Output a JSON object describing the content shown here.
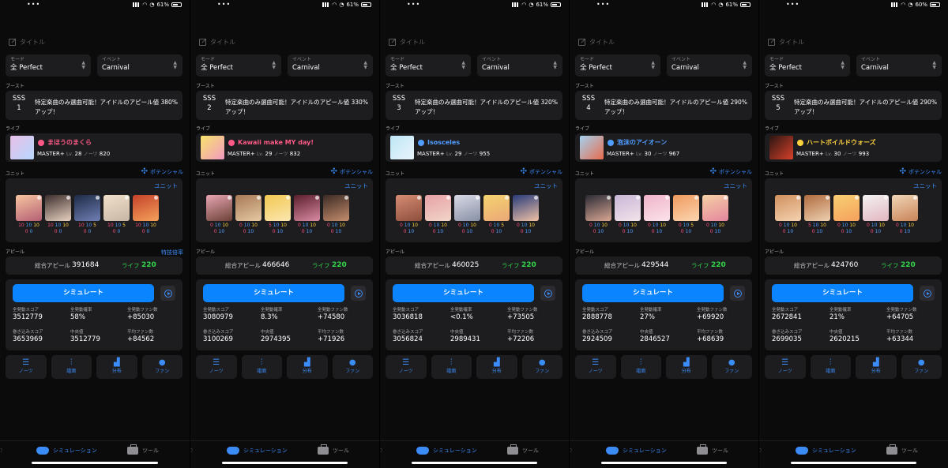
{
  "common": {
    "title_placeholder": "タイトル",
    "mode_label": "モード",
    "mode_value": "全 Perfect",
    "event_label": "イベント",
    "event_value": "Carnival",
    "boost_section": "ブースト",
    "live_section": "ライブ",
    "unit_section": "ユニット",
    "potential_label": "ポテンシャル",
    "unit_link": "ユニット",
    "appeal_section": "アピール",
    "tokugi_label": "特技倍率",
    "total_appeal_label": "総合アピール",
    "life_label": "ライフ",
    "simulate_label": "シミュレート",
    "stat_labels": {
      "full_score": "全発動スコア",
      "full_rate": "全発動確率",
      "full_fan": "全発動ファン数",
      "high_score": "巻き込みスコア",
      "median": "中央値",
      "avg_fan": "平均ファン数"
    },
    "tabs": [
      {
        "label": "ノーツ",
        "icon": "list-icon",
        "glyph": "☰"
      },
      {
        "label": "譜面",
        "icon": "sliders-icon",
        "glyph": "⫶"
      },
      {
        "label": "分布",
        "icon": "bar-chart-icon",
        "glyph": "▟"
      },
      {
        "label": "ファン",
        "icon": "person-icon",
        "glyph": "●"
      }
    ],
    "nav_simulation": "シミュレーション",
    "nav_tool": "ツール",
    "colors": {
      "accent": "#0a84ff",
      "card": "#1d1d20",
      "life_green": "#32d74b",
      "cute": "#ff4f7a",
      "cool": "#4f9dff",
      "passion": "#ffd23f"
    }
  },
  "screens": [
    {
      "battery": "61%",
      "rank": "SSS",
      "rank_num": "1",
      "boost_desc": "特定楽曲のみ選曲可能！アイドルのアピール値 380% アップ！",
      "song": {
        "title": "まほうのまくら",
        "attr": "cute",
        "color": "#ff5a86",
        "difficulty": "MASTER+",
        "level": "28",
        "notes": "820",
        "jacket": [
          "#e8c0e6",
          "#b7d7ff"
        ]
      },
      "idols": [
        {
          "points": [
            "10",
            "10",
            "10"
          ],
          "sub": [
            "0",
            "0"
          ],
          "colors": [
            "#f7c6a0",
            "#b45f74"
          ]
        },
        {
          "points": [
            "10",
            "10",
            "10"
          ],
          "sub": [
            "0",
            "0"
          ],
          "colors": [
            "#3c2d2c",
            "#e8d1c1"
          ]
        },
        {
          "points": [
            "10",
            "10",
            "5"
          ],
          "sub": [
            "0",
            "0"
          ],
          "colors": [
            "#1d2a46",
            "#6f7fb3"
          ]
        },
        {
          "points": [
            "10",
            "10",
            "5"
          ],
          "sub": [
            "0",
            "0"
          ],
          "colors": [
            "#f1e0c8",
            "#c8b6a6"
          ]
        },
        {
          "points": [
            "10",
            "10",
            "10"
          ],
          "sub": [
            "0",
            "0"
          ],
          "colors": [
            "#c4422a",
            "#f4a15b"
          ]
        }
      ],
      "total_appeal": "391684",
      "life": "220",
      "show_tokugi": true,
      "stats": {
        "full_score": "3512779",
        "full_rate": "58%",
        "full_fan": "+85030",
        "high_score": "3653969",
        "median": "3512779",
        "avg_fan": "+84562"
      }
    },
    {
      "battery": "61%",
      "rank": "SSS",
      "rank_num": "2",
      "boost_desc": "特定楽曲のみ選曲可能！アイドルのアピール値 330% アップ！",
      "song": {
        "title": "Kawaii make MY day!",
        "attr": "cute",
        "color": "#ff5a86",
        "difficulty": "MASTER+",
        "level": "29",
        "notes": "832",
        "jacket": [
          "#f7e36b",
          "#f29ac1"
        ]
      },
      "idols": [
        {
          "points": [
            "0",
            "10",
            "10"
          ],
          "sub": [
            "0",
            "10"
          ],
          "colors": [
            "#e8a6b4",
            "#6b4136"
          ]
        },
        {
          "points": [
            "0",
            "10",
            "10"
          ],
          "sub": [
            "0",
            "10"
          ],
          "colors": [
            "#a87955",
            "#e5c8a4"
          ]
        },
        {
          "points": [
            "5",
            "10",
            "10"
          ],
          "sub": [
            "0",
            "10"
          ],
          "colors": [
            "#f2c851",
            "#fbe6b0"
          ]
        },
        {
          "points": [
            "0",
            "10",
            "10"
          ],
          "sub": [
            "0",
            "10"
          ],
          "colors": [
            "#5a1e2c",
            "#d98ba3"
          ]
        },
        {
          "points": [
            "0",
            "10",
            "10"
          ],
          "sub": [
            "0",
            "10"
          ],
          "colors": [
            "#3b2a24",
            "#c58d6d"
          ]
        }
      ],
      "total_appeal": "466646",
      "life": "220",
      "show_tokugi": false,
      "stats": {
        "full_score": "3080979",
        "full_rate": "8.3%",
        "full_fan": "+74580",
        "high_score": "3100269",
        "median": "2974395",
        "avg_fan": "+71926"
      }
    },
    {
      "battery": "61%",
      "rank": "SSS",
      "rank_num": "3",
      "boost_desc": "特定楽曲のみ選曲可能！アイドルのアピール値 320% アップ！",
      "song": {
        "title": "Isosceles",
        "attr": "cool",
        "color": "#4f9dff",
        "difficulty": "MASTER+",
        "level": "29",
        "notes": "955",
        "jacket": [
          "#bfe6f7",
          "#e8f4fb"
        ]
      },
      "idols": [
        {
          "points": [
            "0",
            "10",
            "10"
          ],
          "sub": [
            "0",
            "10"
          ],
          "colors": [
            "#d78c74",
            "#8d4f3c"
          ]
        },
        {
          "points": [
            "0",
            "10",
            "10"
          ],
          "sub": [
            "0",
            "10"
          ],
          "colors": [
            "#e7a1a6",
            "#f1d5c8"
          ]
        },
        {
          "points": [
            "0",
            "10",
            "10"
          ],
          "sub": [
            "0",
            "10"
          ],
          "colors": [
            "#d9dbe6",
            "#8890a6"
          ]
        },
        {
          "points": [
            "0",
            "10",
            "5"
          ],
          "sub": [
            "0",
            "10"
          ],
          "colors": [
            "#f3d36e",
            "#eba878"
          ]
        },
        {
          "points": [
            "0",
            "10",
            "10"
          ],
          "sub": [
            "0",
            "10"
          ],
          "colors": [
            "#273b7a",
            "#f0c2a5"
          ]
        }
      ],
      "total_appeal": "460025",
      "life": "220",
      "show_tokugi": false,
      "stats": {
        "full_score": "3036818",
        "full_rate": "<0.1%",
        "full_fan": "+73505",
        "high_score": "3056824",
        "median": "2989431",
        "avg_fan": "+72206"
      }
    },
    {
      "battery": "61%",
      "rank": "SSS",
      "rank_num": "4",
      "boost_desc": "特定楽曲のみ選曲可能！アイドルのアピール値 290% アップ！",
      "song": {
        "title": "泡沫のアイオーン",
        "attr": "cool",
        "color": "#4f9dff",
        "difficulty": "MASTER+",
        "level": "30",
        "notes": "967",
        "jacket": [
          "#a3d3f0",
          "#e86b4d"
        ]
      },
      "idols": [
        {
          "points": [
            "0",
            "10",
            "10"
          ],
          "sub": [
            "0",
            "10"
          ],
          "colors": [
            "#2a2a35",
            "#d9a793"
          ]
        },
        {
          "points": [
            "0",
            "10",
            "10"
          ],
          "sub": [
            "0",
            "10"
          ],
          "colors": [
            "#c8b6d6",
            "#f2e3ea"
          ]
        },
        {
          "points": [
            "0",
            "10",
            "10"
          ],
          "sub": [
            "0",
            "10"
          ],
          "colors": [
            "#efb3c9",
            "#fbe3ea"
          ]
        },
        {
          "points": [
            "0",
            "10",
            "5"
          ],
          "sub": [
            "0",
            "10"
          ],
          "colors": [
            "#f09a5e",
            "#fbd6b0"
          ]
        },
        {
          "points": [
            "0",
            "10",
            "10"
          ],
          "sub": [
            "0",
            "10"
          ],
          "colors": [
            "#f5d0a4",
            "#e4869e"
          ]
        }
      ],
      "total_appeal": "429544",
      "life": "220",
      "show_tokugi": false,
      "stats": {
        "full_score": "2888778",
        "full_rate": "27%",
        "full_fan": "+69920",
        "high_score": "2924509",
        "median": "2846527",
        "avg_fan": "+68639"
      }
    },
    {
      "battery": "60%",
      "rank": "SSS",
      "rank_num": "5",
      "boost_desc": "特定楽曲のみ選曲可能！アイドルのアピール値 290% アップ！",
      "song": {
        "title": "ハートボイルドウォーズ",
        "attr": "passion",
        "color": "#ffd23f",
        "difficulty": "MASTER+",
        "level": "30",
        "notes": "993",
        "jacket": [
          "#2a1612",
          "#d7402a"
        ]
      },
      "idols": [
        {
          "points": [
            "0",
            "10",
            "10"
          ],
          "sub": [
            "0",
            "10"
          ],
          "colors": [
            "#d0905d",
            "#f4d2b1"
          ]
        },
        {
          "points": [
            "5",
            "10",
            "10"
          ],
          "sub": [
            "0",
            "10"
          ],
          "colors": [
            "#b06b3f",
            "#edd0b1"
          ]
        },
        {
          "points": [
            "0",
            "10",
            "10"
          ],
          "sub": [
            "0",
            "10"
          ],
          "colors": [
            "#f5cf73",
            "#f7a15c"
          ]
        },
        {
          "points": [
            "0",
            "10",
            "10"
          ],
          "sub": [
            "0",
            "10"
          ],
          "colors": [
            "#f2f2f2",
            "#e3b6c1"
          ]
        },
        {
          "points": [
            "0",
            "10",
            "10"
          ],
          "sub": [
            "0",
            "10"
          ],
          "colors": [
            "#f0d6b6",
            "#c98358"
          ]
        }
      ],
      "total_appeal": "424760",
      "life": "220",
      "show_tokugi": false,
      "stats": {
        "full_score": "2672841",
        "full_rate": "21%",
        "full_fan": "+64705",
        "high_score": "2699035",
        "median": "2620215",
        "avg_fan": "+63344"
      }
    }
  ]
}
